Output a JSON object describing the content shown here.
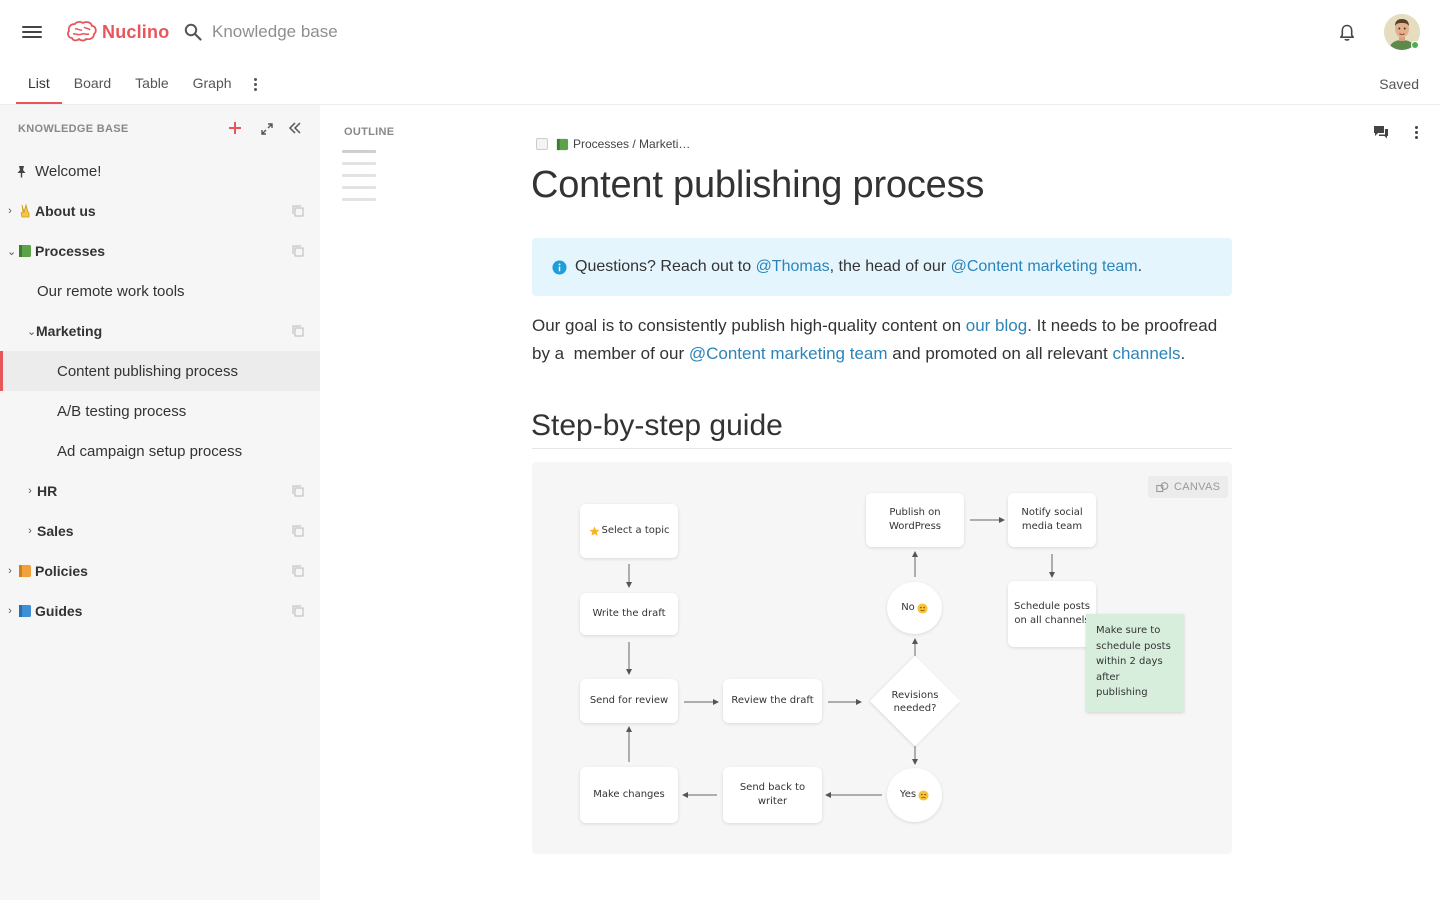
{
  "app": {
    "name": "Nuclino"
  },
  "search": {
    "placeholder": "Knowledge base"
  },
  "tabs": [
    {
      "label": "List",
      "active": true
    },
    {
      "label": "Board",
      "active": false
    },
    {
      "label": "Table",
      "active": false
    },
    {
      "label": "Graph",
      "active": false
    }
  ],
  "status": {
    "saved": "Saved"
  },
  "sidebar": {
    "heading": "KNOWLEDGE BASE",
    "items": [
      {
        "label": "Welcome!"
      },
      {
        "label": "About us"
      },
      {
        "label": "Processes"
      },
      {
        "label": "Our remote work tools"
      },
      {
        "label": "Marketing"
      },
      {
        "label": "Content publishing process"
      },
      {
        "label": "A/B testing process"
      },
      {
        "label": "Ad campaign setup process"
      },
      {
        "label": "HR"
      },
      {
        "label": "Sales"
      },
      {
        "label": "Policies"
      },
      {
        "label": "Guides"
      }
    ]
  },
  "outline": {
    "heading": "OUTLINE"
  },
  "document": {
    "breadcrumb": "Processes / Marketi…",
    "title": "Content publishing process",
    "callout": {
      "prefix": "Questions? Reach out to ",
      "mention1": "@Thomas",
      "middle": ", the head of our ",
      "mention2": "@Content marketing team",
      "suffix": "."
    },
    "paragraph": {
      "part1": "Our goal is to consistently publish high-quality content on ",
      "link1": "our blog",
      "part2": ". It needs to be proofread by a  member of our ",
      "mention": "@Content marketing team",
      "part3": " and promoted on all relevant ",
      "link2": "channels",
      "part4": "."
    },
    "heading2": "Step-by-step guide"
  },
  "canvas": {
    "badge": "CANVAS",
    "nodes": {
      "select_topic": "Select a topic",
      "write_draft": "Write the draft",
      "send_review": "Send for review",
      "make_changes": "Make changes",
      "review_draft": "Review the draft",
      "send_back": "Send back to writer",
      "revisions": "Revisions needed?",
      "no": "No",
      "yes": "Yes",
      "publish": "Publish on WordPress",
      "notify": "Notify social media team",
      "schedule": "Schedule posts on all channels"
    },
    "sticky": "Make sure to schedule posts within 2 days after publishing"
  },
  "colors": {
    "brand": "#e8555b",
    "link": "#2c84b8",
    "callout_bg": "#e5f5fd",
    "sticky": "#d8eedd"
  }
}
